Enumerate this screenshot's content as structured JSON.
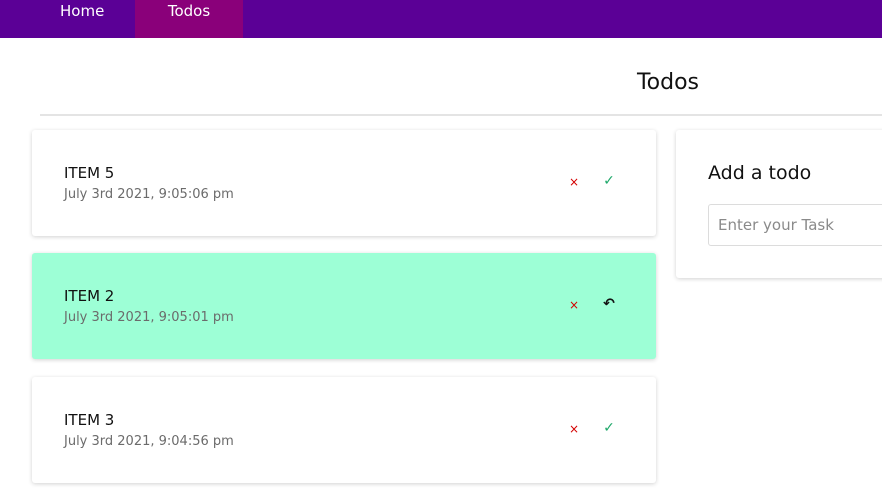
{
  "nav": {
    "home_label": "Home",
    "todos_label": "Todos"
  },
  "page": {
    "title": "Todos"
  },
  "todos": [
    {
      "title": "ITEM 5",
      "time": "July 3rd 2021, 9:05:06 pm",
      "completed": false,
      "delete_icon": "×",
      "action_icon": "✓"
    },
    {
      "title": "ITEM 2",
      "time": "July 3rd 2021, 9:05:01 pm",
      "completed": true,
      "delete_icon": "×",
      "action_icon": "↶"
    },
    {
      "title": "ITEM 3",
      "time": "July 3rd 2021, 9:04:56 pm",
      "completed": false,
      "delete_icon": "×",
      "action_icon": "✓"
    }
  ],
  "add_todo": {
    "title": "Add a todo",
    "input_placeholder": "Enter your Task",
    "input_value": ""
  },
  "colors": {
    "navbar": "#5b0096",
    "active_nav": "#8a007a",
    "completed_card": "#9dffd6",
    "delete": "#d40000",
    "complete": "#1ea86a"
  }
}
